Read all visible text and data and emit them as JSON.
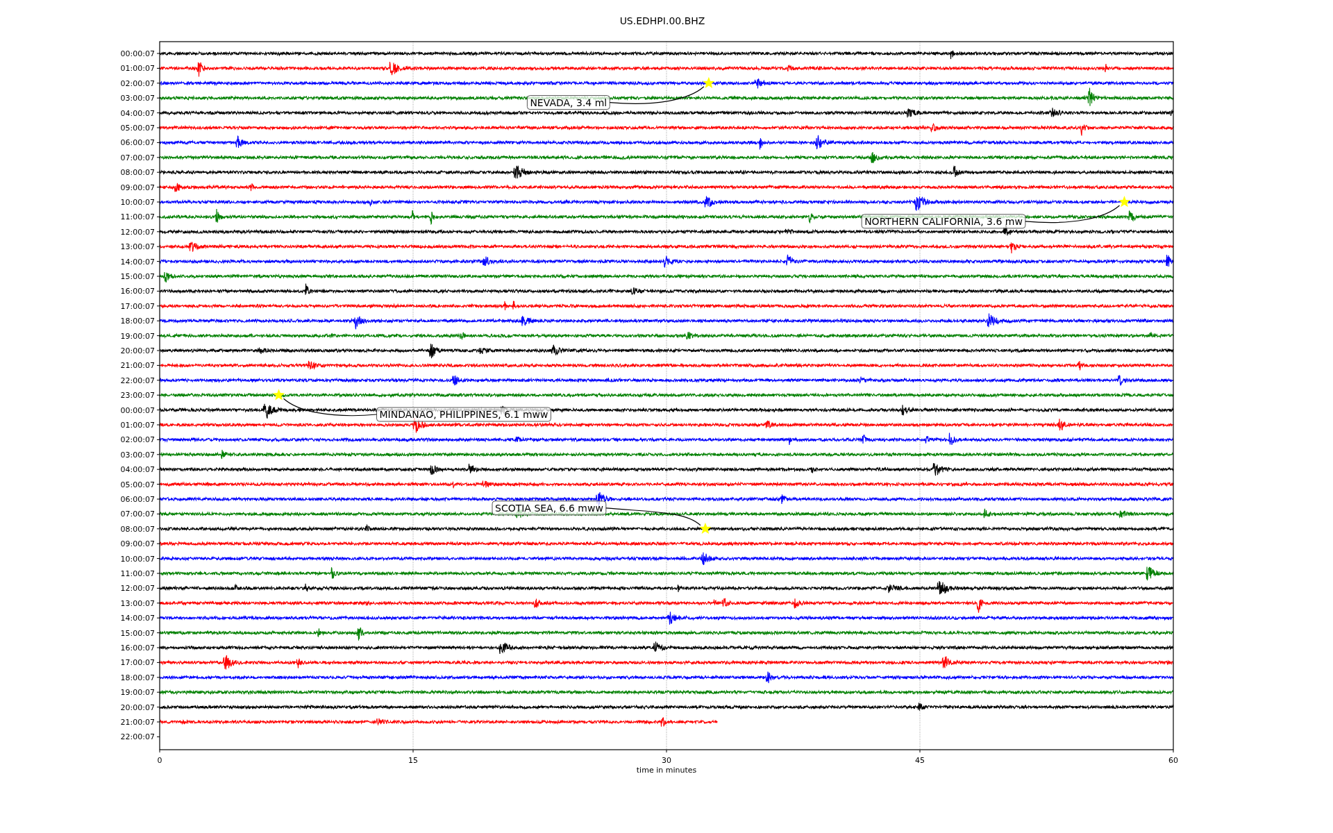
{
  "title": "US.EDHPI.00.BHZ",
  "plot": {
    "x_label": "time in minutes",
    "x_ticks": [
      "0",
      "15",
      "30",
      "45",
      "60"
    ],
    "rows": [
      {
        "label": "00:00:07",
        "color": "#000000",
        "level": 1
      },
      {
        "label": "01:00:07",
        "color": "#ff0000",
        "level": 1
      },
      {
        "label": "02:00:07",
        "color": "#0000ff",
        "level": 1
      },
      {
        "label": "03:00:07",
        "color": "#008000",
        "level": 1
      },
      {
        "label": "04:00:07",
        "color": "#000000",
        "level": 1
      },
      {
        "label": "05:00:07",
        "color": "#ff0000",
        "level": 1
      },
      {
        "label": "06:00:07",
        "color": "#0000ff",
        "level": 1
      },
      {
        "label": "07:00:07",
        "color": "#008000",
        "level": 1
      },
      {
        "label": "08:00:07",
        "color": "#000000",
        "level": 1
      },
      {
        "label": "09:00:07",
        "color": "#ff0000",
        "level": 1
      },
      {
        "label": "10:00:07",
        "color": "#0000ff",
        "level": 1
      },
      {
        "label": "11:00:07",
        "color": "#008000",
        "level": 1
      },
      {
        "label": "12:00:07",
        "color": "#000000",
        "level": 1
      },
      {
        "label": "13:00:07",
        "color": "#ff0000",
        "level": 1
      },
      {
        "label": "14:00:07",
        "color": "#0000ff",
        "level": 1
      },
      {
        "label": "15:00:07",
        "color": "#008000",
        "level": 1
      },
      {
        "label": "16:00:07",
        "color": "#000000",
        "level": 1
      },
      {
        "label": "17:00:07",
        "color": "#ff0000",
        "level": 1
      },
      {
        "label": "18:00:07",
        "color": "#0000ff",
        "level": 1
      },
      {
        "label": "19:00:07",
        "color": "#008000",
        "level": 1
      },
      {
        "label": "20:00:07",
        "color": "#000000",
        "level": 1
      },
      {
        "label": "21:00:07",
        "color": "#ff0000",
        "level": 1
      },
      {
        "label": "22:00:07",
        "color": "#0000ff",
        "level": 1
      },
      {
        "label": "23:00:07",
        "color": "#008000",
        "level": 1
      },
      {
        "label": "00:00:07",
        "color": "#000000",
        "level": 1
      },
      {
        "label": "01:00:07",
        "color": "#ff0000",
        "level": 1
      },
      {
        "label": "02:00:07",
        "color": "#0000ff",
        "level": 1
      },
      {
        "label": "03:00:07",
        "color": "#008000",
        "level": 1
      },
      {
        "label": "04:00:07",
        "color": "#000000",
        "level": 1
      },
      {
        "label": "05:00:07",
        "color": "#ff0000",
        "level": 1
      },
      {
        "label": "06:00:07",
        "color": "#0000ff",
        "level": 1
      },
      {
        "label": "07:00:07",
        "color": "#008000",
        "level": 1
      },
      {
        "label": "08:00:07",
        "color": "#000000",
        "level": 1
      },
      {
        "label": "09:00:07",
        "color": "#ff0000",
        "level": 1
      },
      {
        "label": "10:00:07",
        "color": "#0000ff",
        "level": 1
      },
      {
        "label": "11:00:07",
        "color": "#008000",
        "level": 1
      },
      {
        "label": "12:00:07",
        "color": "#000000",
        "level": 1
      },
      {
        "label": "13:00:07",
        "color": "#ff0000",
        "level": 1
      },
      {
        "label": "14:00:07",
        "color": "#0000ff",
        "level": 1
      },
      {
        "label": "15:00:07",
        "color": "#008000",
        "level": 1
      },
      {
        "label": "16:00:07",
        "color": "#000000",
        "level": 1
      },
      {
        "label": "17:00:07",
        "color": "#ff0000",
        "level": 1
      },
      {
        "label": "18:00:07",
        "color": "#0000ff",
        "level": 1
      },
      {
        "label": "19:00:07",
        "color": "#008000",
        "level": 1
      },
      {
        "label": "20:00:07",
        "color": "#000000",
        "level": 1
      },
      {
        "label": "21:00:07",
        "color": "#ff0000",
        "level": 0.55
      },
      {
        "label": "22:00:07"
      }
    ],
    "events": [
      {
        "text": "NEVADA, 3.4 ml"
      },
      {
        "text": "NORTHERN CALIFORNIA, 3.6 mw"
      },
      {
        "text": "MINDANAO, PHILIPPINES, 6.1 mww"
      },
      {
        "text": "SCOTIA SEA, 6.6 mww"
      }
    ]
  }
}
